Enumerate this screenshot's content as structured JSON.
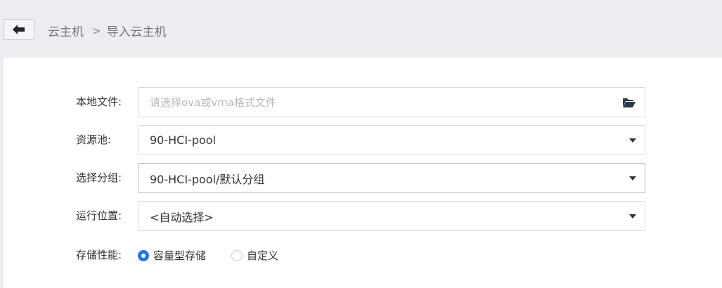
{
  "header": {
    "breadcrumb_root": "云主机",
    "breadcrumb_sep": ">",
    "breadcrumb_current": "导入云主机"
  },
  "form": {
    "local_file": {
      "label": "本地文件:",
      "placeholder": "请选择ova或vma格式文件",
      "value": ""
    },
    "resource_pool": {
      "label": "资源池:",
      "value": "90-HCI-pool"
    },
    "group": {
      "label": "选择分组:",
      "value": "90-HCI-pool/默认分组"
    },
    "location": {
      "label": "运行位置:",
      "value": "<自动选择>"
    },
    "storage": {
      "label": "存储性能:",
      "options": [
        "容量型存储",
        "自定义"
      ],
      "selected": "容量型存储"
    }
  },
  "colors": {
    "accent": "#1e78e6",
    "page_bg": "#ebedf0",
    "panel_bg": "#ffffff"
  },
  "icons": {
    "back": "arrow-left-icon",
    "file": "folder-open-icon",
    "dropdown": "caret-down-icon"
  }
}
